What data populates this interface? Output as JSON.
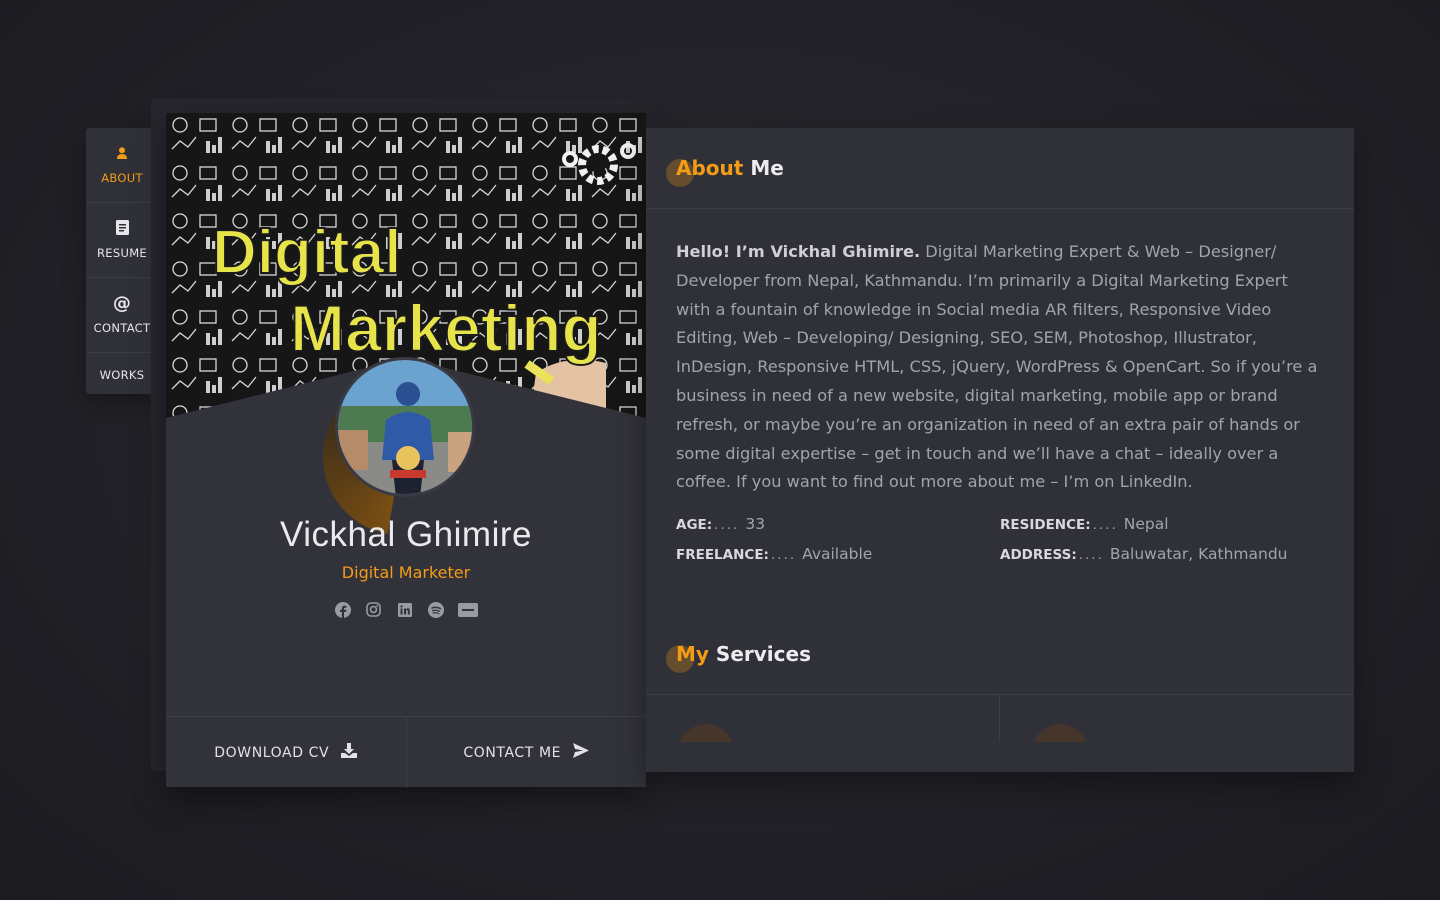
{
  "nav": {
    "items": [
      {
        "label": "ABOUT",
        "icon": "user-icon"
      },
      {
        "label": "RESUME",
        "icon": "document-icon"
      },
      {
        "label": "CONTACT",
        "icon": "at-icon"
      },
      {
        "label": "WORKS",
        "icon": ""
      }
    ]
  },
  "profile": {
    "cover_text_line1": "Digital",
    "cover_text_line2": "Marketing",
    "name": "Vickhal Ghimire",
    "role": "Digital Marketer",
    "socials": [
      "facebook-icon",
      "instagram-icon",
      "linkedin-icon",
      "spotify-icon",
      "paypal-icon"
    ],
    "download_label": "DOWNLOAD CV",
    "contact_label": "CONTACT ME"
  },
  "about": {
    "title_highlight": "About",
    "title_rest": "Me",
    "intro_bold": "Hello! I’m Vickhal Ghimire.",
    "intro_text": " Digital Marketing Expert & Web – Designer/ Developer from Nepal, Kathmandu.   I’m primarily a Digital Marketing Expert with a fountain of knowledge in Social media AR filters, Responsive Video Editing, Web – Developing/ Designing, SEO, SEM, Photoshop, Illustrator, InDesign, Responsive HTML, CSS, jQuery, WordPress & OpenCart.   So if you’re a business in need of a new website, digital marketing, mobile app or brand refresh, or maybe you’re an organization in need of an extra pair of hands or some digital expertise – get in touch and we’ll have a chat – ideally over a coffee. If you want to find out more about me – I’m on LinkedIn.",
    "info": {
      "age_label": "AGE:",
      "age_value": "33",
      "residence_label": "RESIDENCE:",
      "residence_value": "Nepal",
      "freelance_label": "FREELANCE:",
      "freelance_value": "Available",
      "address_label": "ADDRESS:",
      "address_value": "Baluwatar, Kathmandu",
      "dots": "...."
    }
  },
  "services": {
    "title_highlight": "My",
    "title_rest": "Services"
  },
  "colors": {
    "accent": "#f59c16",
    "panel": "#303038",
    "card": "#32323a",
    "background": "#1f1f25"
  }
}
